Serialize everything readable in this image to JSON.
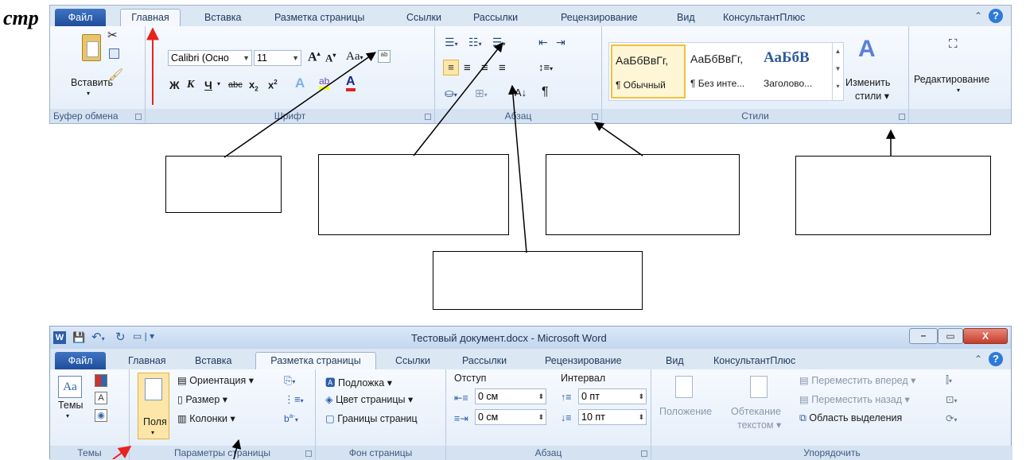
{
  "caption": "стр",
  "top_ribbon": {
    "tabs": [
      "Файл",
      "Главная",
      "Вставка",
      "Разметка страницы",
      "Ссылки",
      "Рассылки",
      "Рецензирование",
      "Вид",
      "КонсультантПлюс"
    ],
    "clipboard": {
      "paste_label": "Вставить",
      "group_label": "Буфер обмена"
    },
    "font": {
      "font_name": "Calibri (Осно",
      "font_size": "11",
      "group_label": "Шрифт"
    },
    "paragraph": {
      "group_label": "Абзац"
    },
    "styles": {
      "items": [
        {
          "sample": "АаБбВвГг,",
          "name": "¶ Обычный"
        },
        {
          "sample": "АаБбВвГг,",
          "name": "¶ Без инте..."
        },
        {
          "sample": "АаБбВ",
          "name": "Заголово..."
        }
      ],
      "change_label_1": "Изменить",
      "change_label_2": "стили ▾",
      "group_label": "Стили"
    },
    "editing": {
      "label": "Редактирование"
    },
    "help_icon": "?"
  },
  "bottom_ribbon": {
    "title": "Тестовый документ.docx - Microsoft Word",
    "tabs": [
      "Файл",
      "Главная",
      "Вставка",
      "Разметка страницы",
      "Ссылки",
      "Рассылки",
      "Рецензирование",
      "Вид",
      "КонсультантПлюс"
    ],
    "themes": {
      "label": "Темы",
      "group_label": "Темы"
    },
    "page_setup": {
      "margins_label": "Поля",
      "orientation": "Ориентация ▾",
      "size": "Размер ▾",
      "columns": "Колонки ▾",
      "group_label": "Параметры страницы"
    },
    "page_background": {
      "watermark": "Подложка ▾",
      "page_color": "Цвет страницы ▾",
      "page_borders": "Границы страниц",
      "group_label": "Фон страницы"
    },
    "paragraph": {
      "indent_label": "Отступ",
      "spacing_label": "Интервал",
      "indent_left": "0 см",
      "indent_right": "0 см",
      "spacing_before": "0 пт",
      "spacing_after": "10 пт",
      "group_label": "Абзац"
    },
    "arrange": {
      "position": "Положение",
      "wrap_1": "Обтекание",
      "wrap_2": "текстом ▾",
      "bring_forward": "Переместить вперед ▾",
      "send_backward": "Переместить назад ▾",
      "selection_pane": "Область выделения",
      "group_label": "Упорядочить"
    }
  },
  "colors": {
    "arrow_red": "#e8231e",
    "file_tab": "#2b5ea8",
    "ribbon_bg": "#dfe9f5"
  }
}
